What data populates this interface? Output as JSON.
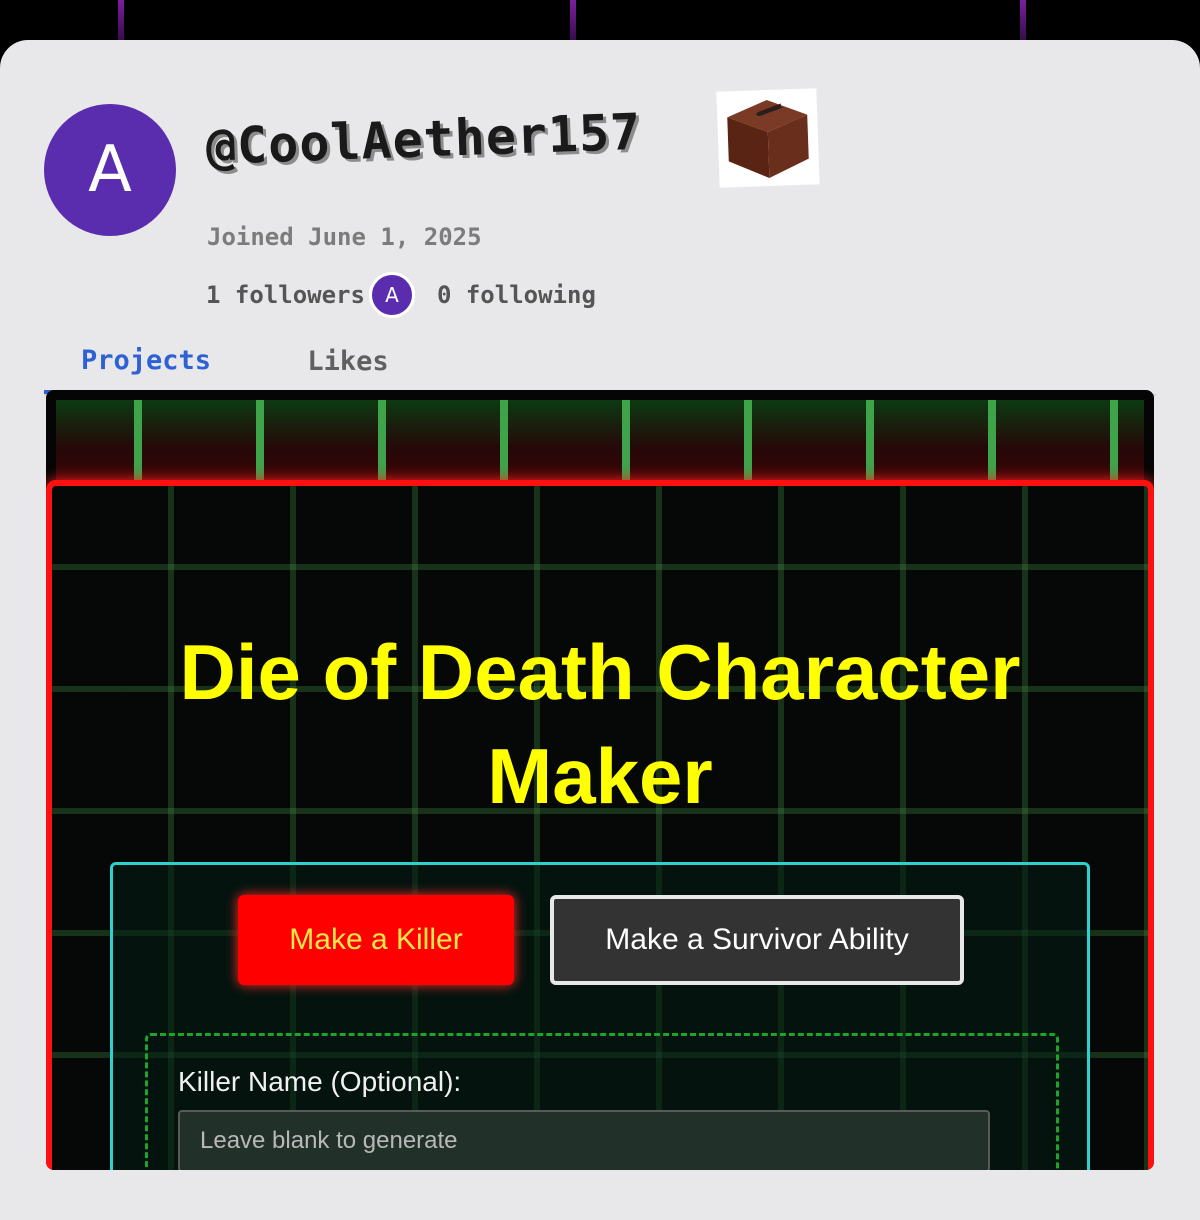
{
  "profile": {
    "avatar_letter": "A",
    "username": "@CoolAether157",
    "joined": "Joined June 1, 2025",
    "followers": "1 followers",
    "follower_avatar_letter": "A",
    "following": "0 following"
  },
  "tabs": [
    {
      "label": "Projects",
      "active": true
    },
    {
      "label": "Likes",
      "active": false
    }
  ],
  "project": {
    "title_line1": "Die of Death Character",
    "title_line2": "Maker",
    "buttons": {
      "killer": "Make a Killer",
      "survivor": "Make a Survivor Ability"
    },
    "form": {
      "killer_name_label": "Killer Name (Optional):",
      "killer_name_placeholder": "Leave blank to generate"
    }
  },
  "colors": {
    "accent_tab": "#2e62d2",
    "avatar": "#5a2cae",
    "title": "#ffff00",
    "killer_button": "#ff0000"
  },
  "icons": {
    "badge": "note-block-icon"
  }
}
